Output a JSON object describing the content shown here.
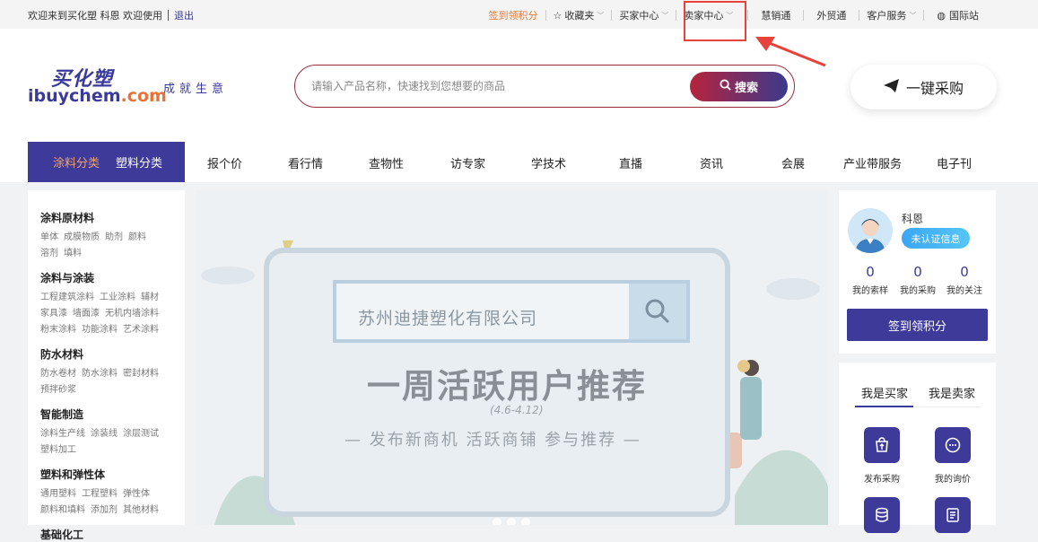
{
  "topbar": {
    "welcome": "欢迎来到买化塑 科恩 欢迎使用",
    "logout": "退出",
    "sign_points": "签到领积分",
    "favorites": "收藏夹",
    "buyer_center": "买家中心",
    "seller_center": "卖家中心",
    "smart_sales": "慧销通",
    "foreign_trade": "外贸通",
    "customer_service": "客户服务",
    "international": "国际站"
  },
  "header": {
    "logo_cn": "买化塑",
    "logo_en_main": "ibuychem",
    "logo_en_suffix": ".com",
    "slogan": "成就生意",
    "search_placeholder": "请输入产品名称，快速找到您想要的商品",
    "search_button": "搜索",
    "one_key_button": "一键采购"
  },
  "nav": {
    "tabs": [
      "涂料分类",
      "塑料分类"
    ],
    "items": [
      "报个价",
      "看行情",
      "查物性",
      "访专家",
      "学技术",
      "直播",
      "资讯",
      "会展",
      "产业带服务",
      "电子刊"
    ]
  },
  "sidebar": {
    "groups": [
      {
        "title": "涂料原材料",
        "links": [
          "单体",
          "成膜物质",
          "助剂",
          "颜料",
          "溶剂",
          "填料"
        ]
      },
      {
        "title": "涂料与涂装",
        "links": [
          "工程建筑涂料",
          "工业涂料",
          "辅材",
          "家具漆",
          "墙面漆",
          "无机内墙涂料",
          "粉末涂料",
          "功能涂料",
          "艺术涂料"
        ]
      },
      {
        "title": "防水材料",
        "links": [
          "防水卷材",
          "防水涂料",
          "密封材料",
          "预拌砂浆"
        ]
      },
      {
        "title": "智能制造",
        "links": [
          "涂料生产线",
          "涂装线",
          "涂层测试",
          "塑料加工"
        ]
      },
      {
        "title": "塑料和弹性体",
        "links": [
          "通用塑料",
          "工程塑料",
          "弹性体",
          "颜料和填料",
          "添加剂",
          "其他材料"
        ]
      },
      {
        "title": "基础化工",
        "links": []
      }
    ]
  },
  "banner": {
    "search_text": "苏州迪捷塑化有限公司",
    "headline": "一周活跃用户推荐",
    "date": "(4.6-4.12)",
    "subline": "— 发布新商机 活跃商铺 参与推荐 —"
  },
  "user": {
    "name": "科恩",
    "badge": "未认证信息",
    "stats": [
      {
        "num": "0",
        "label": "我的索样"
      },
      {
        "num": "0",
        "label": "我的采购"
      },
      {
        "num": "0",
        "label": "我的关注"
      }
    ],
    "sign_button": "签到领积分"
  },
  "roles": {
    "tabs": [
      "我是买家",
      "我是卖家"
    ],
    "actions": [
      {
        "icon": "publish-purchase-icon",
        "label": "发布采购"
      },
      {
        "icon": "my-inquiry-icon",
        "label": "我的询价"
      },
      {
        "icon": "database-icon",
        "label": ""
      },
      {
        "icon": "document-icon",
        "label": ""
      }
    ]
  },
  "colors": {
    "brand": "#3d3a9a",
    "accent": "#e07b39",
    "highlight": "#e8423c"
  }
}
